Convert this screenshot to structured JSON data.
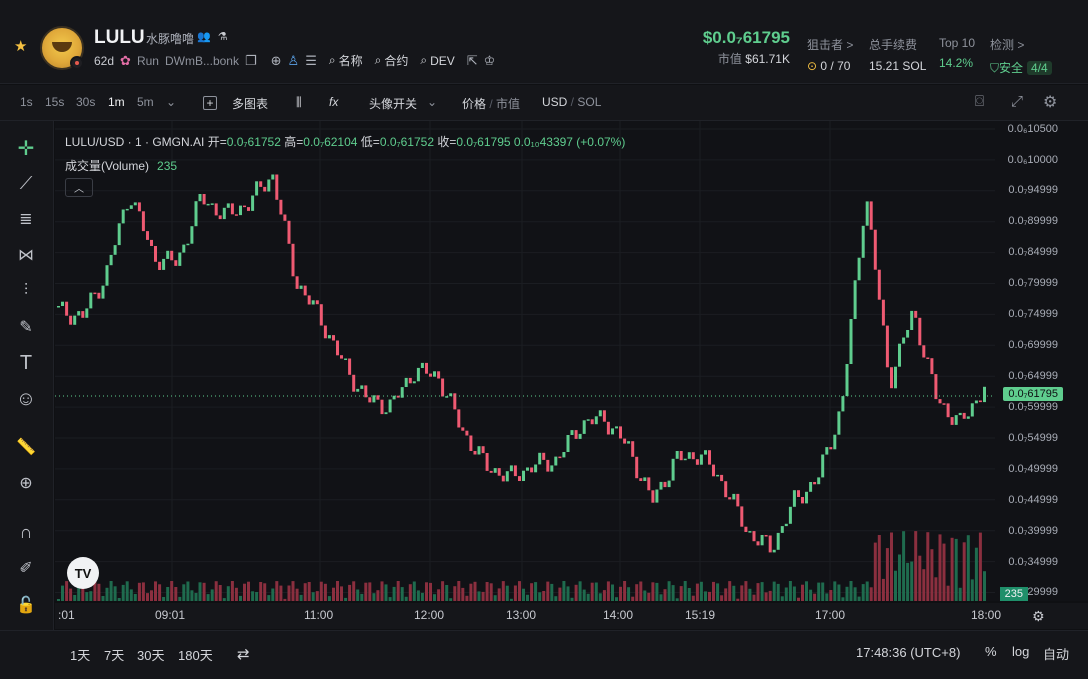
{
  "token": {
    "symbol": "LULU",
    "name": "水豚噜噜",
    "age": "62d",
    "run_label": "Run",
    "address": "DWmB...bonk",
    "links": [
      "名称",
      "合约",
      "DEV"
    ]
  },
  "price": {
    "value": "$0.0₇61795",
    "mcap_label": "市值",
    "mcap_value": "$61.71K"
  },
  "stats": [
    {
      "label": "狙击者 >",
      "value": "0 / 70"
    },
    {
      "label": "总手续费",
      "value": "15.21 SOL"
    },
    {
      "label": "Top 10",
      "value": "14.2%"
    },
    {
      "label": "检测 >",
      "value": "安全",
      "badge": "4/4"
    }
  ],
  "toolbar": {
    "intervals": [
      "1s",
      "15s",
      "30s",
      "1m",
      "5m"
    ],
    "active_interval": "1m",
    "multi_chart": "多图表",
    "avatar_toggle": "头像开关",
    "price_label": "价格",
    "mcap_label": "市值",
    "usd_label": "USD",
    "sol_label": "SOL"
  },
  "legend": {
    "pair": "LULU/USD · 1 · GMGN.AI",
    "open_label": "开=",
    "open": "0.0₇61752",
    "high_label": "高=",
    "high": "0.0₇62104",
    "low_label": "低=",
    "low": "0.0₇61752",
    "close_label": "收=",
    "close": "0.0₇61795",
    "change": "0.0₁₀43397 (+0.07%)",
    "volume_label": "成交量(Volume)",
    "volume_value": "235"
  },
  "axis": {
    "y_ticks": [
      "0.0₆10500",
      "0.0₆10000",
      "0.0₇94999",
      "0.0₇89999",
      "0.0₇84999",
      "0.0₇79999",
      "0.0₇74999",
      "0.0₇69999",
      "0.0₇64999",
      "0.0₇59999",
      "0.0₇54999",
      "0.0₇49999",
      "0.0₇44999",
      "0.0₇39999",
      "0.0₇34999",
      "0.0₇29999"
    ],
    "current_price_label": "0.0₇61795",
    "volume_tag": "235",
    "x_ticks": [
      ":01",
      "09:01",
      "11:00",
      "12:00",
      "13:00",
      "14:00",
      "15:19",
      "17:00",
      "18:00"
    ]
  },
  "chart_data": {
    "type": "candlestick",
    "interval": "1m",
    "ylim": [
      2.99999e-08,
      1.05e-07
    ],
    "close_series_approx": [
      7.45e-08,
      7.35e-08,
      8.05e-08,
      9.45e-08,
      8.35e-08,
      8.25e-08,
      9.35e-08,
      9.05e-08,
      9.25e-08,
      9.75e-08,
      7.95e-08,
      7.35e-08,
      6.55e-08,
      5.95e-08,
      5.85e-08,
      6.45e-08,
      6.35e-08,
      5.45e-08,
      4.85e-08,
      4.65e-08,
      4.85e-08,
      4.95e-08,
      5.55e-08,
      5.65e-08,
      5.15e-08,
      4.25e-08,
      4.95e-08,
      5.05e-08,
      4.55e-08,
      3.75e-08,
      3.45e-08,
      4.25e-08,
      4.65e-08,
      5.85e-08,
      9.45e-08,
      6.25e-08,
      7.45e-08,
      5.95e-08,
      5.55e-08,
      6.18e-08
    ]
  },
  "bottom": {
    "ranges": [
      "1天",
      "7天",
      "30天",
      "180天"
    ],
    "clock": "17:48:36 (UTC+8)",
    "options": [
      "%",
      "log",
      "自动"
    ]
  }
}
